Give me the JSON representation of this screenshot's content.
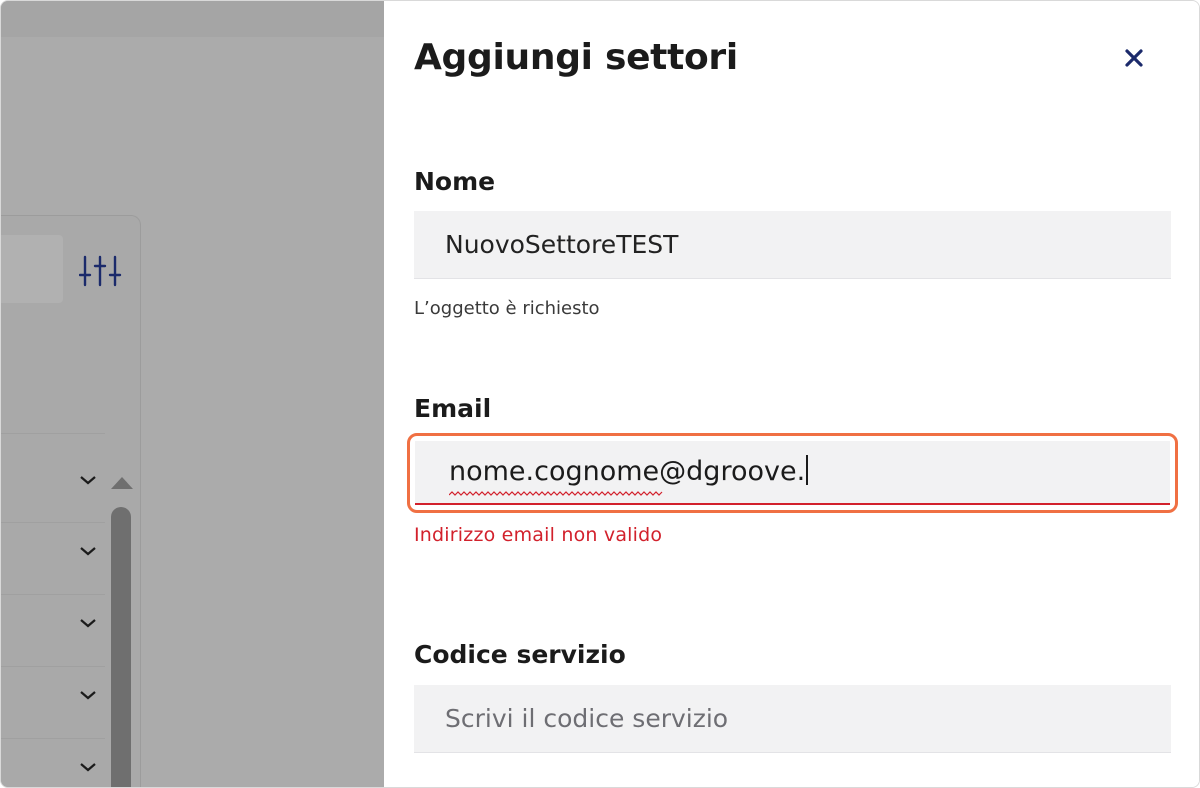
{
  "drawer": {
    "title": "Aggiungi settori",
    "close_icon": "close-icon"
  },
  "form": {
    "nome": {
      "label": "Nome",
      "value": "NuovoSettoreTEST",
      "hint": "L’oggetto è richiesto"
    },
    "email": {
      "label": "Email",
      "value": "nome.cognome@dgroove.",
      "error": "Indirizzo email non valido"
    },
    "codice_servizio": {
      "label": "Codice servizio",
      "placeholder": "Scrivi il codice servizio"
    }
  },
  "background": {
    "filter_icon": "filter-sliders-icon",
    "row_chevron_icon": "chevron-down-icon",
    "scroll_up_icon": "scroll-up-arrow-icon"
  },
  "colors": {
    "focus_ring": "#f07043",
    "error": "#d2212c",
    "icon_navy": "#1b2a6b",
    "overlay": "#ababab"
  }
}
